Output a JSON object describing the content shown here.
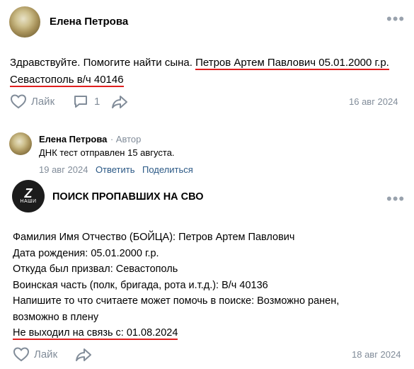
{
  "post": {
    "author": "Елена Петрова",
    "text_plain": "Здравствуйте. Помогите найти сына.",
    "text_highlight_1": "Петров Артем Павлович 05.01.2000 г.р.",
    "text_highlight_2": "Севастополь в/ч 40146",
    "like_label": "Лайк",
    "comments_count": "1",
    "date": "16 авг 2024"
  },
  "comment": {
    "author": "Елена Петрова",
    "author_tag": "· Автор",
    "text": "ДНК тест отправлен 15 августа.",
    "date": "19 авг 2024",
    "reply_label": "Ответить",
    "share_label": "Поделиться"
  },
  "group_post": {
    "avatar_text": "Z",
    "avatar_subtext": "НАШИ",
    "name": "ПОИСК ПРОПАВШИХ НА СВО",
    "line1": "Фамилия Имя Отчество (БОЙЦА): Петров Артем Павлович",
    "line2": "Дата рождения: 05.01.2000 г.р.",
    "line3": "Откуда был призвал: Севастополь",
    "line4": "Воинская часть (полк, бригада, рота и.т.д.): В/ч 40136",
    "line5": "Напишите то что считаете может помочь в поиске: Возможно ранен,",
    "line6": "возможно в плену",
    "line7": "Не выходил на связь с: 01.08.2024",
    "like_label": "Лайк",
    "date": "18 авг 2024"
  },
  "colors": {
    "accent_link": "#2a5885",
    "muted": "#818c99",
    "highlight_underline": "#e01e1e"
  }
}
